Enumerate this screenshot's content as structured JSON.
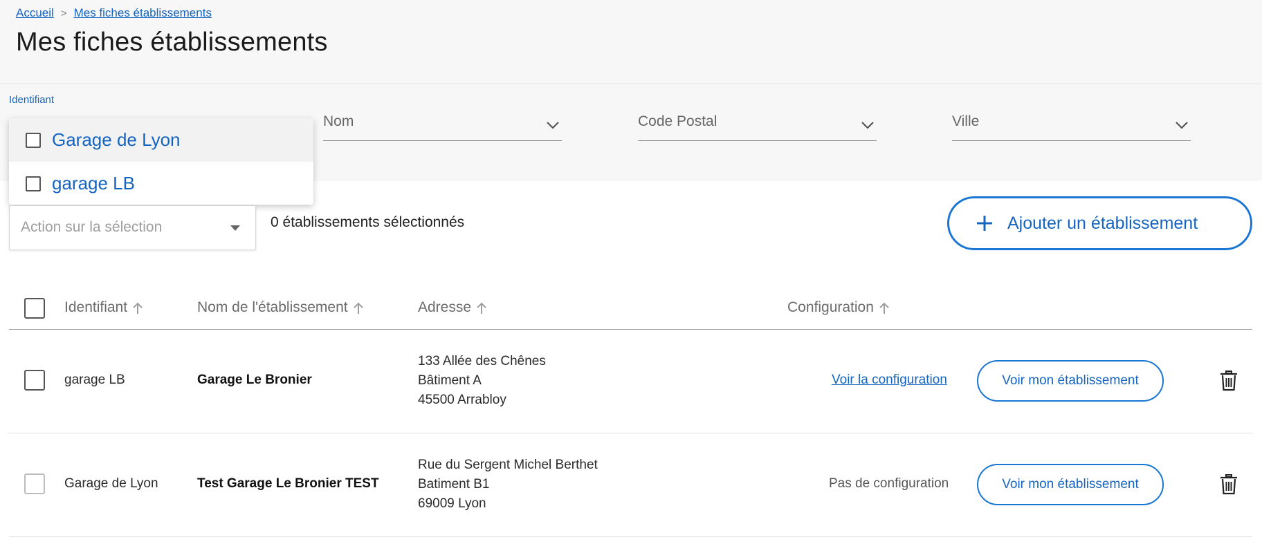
{
  "breadcrumb": {
    "home": "Accueil",
    "separator": ">",
    "current": "Mes fiches établissements"
  },
  "page_title": "Mes fiches établissements",
  "filters": {
    "identifiant_label": "Identifiant",
    "nom": "Nom",
    "code_postal": "Code Postal",
    "ville": "Ville"
  },
  "identifiant_dropdown": {
    "options": [
      {
        "label": "Garage de Lyon",
        "checked": false,
        "hovered": true
      },
      {
        "label": "garage LB",
        "checked": false,
        "hovered": false
      }
    ]
  },
  "selection": {
    "action_placeholder": "Action sur la sélection",
    "count_text": "0 établissements sélectionnés"
  },
  "add_button": {
    "label": "Ajouter un établissement",
    "icon": "plus-icon"
  },
  "table": {
    "headers": {
      "identifiant": "Identifiant",
      "nom": "Nom de l'établissement",
      "adresse": "Adresse",
      "configuration": "Configuration"
    },
    "rows": [
      {
        "identifiant": "garage LB",
        "nom": "Garage Le Bronier",
        "adresse": [
          "133 Allée des Chênes",
          "Bâtiment A",
          "45500 Arrabloy"
        ],
        "configuration": "Voir la configuration",
        "has_configuration": true,
        "voir_label": "Voir mon établissement"
      },
      {
        "identifiant": "Garage de Lyon",
        "nom": "Test Garage Le Bronier TEST",
        "adresse": [
          "Rue du Sergent Michel Berthet",
          "Batiment B1",
          "69009 Lyon"
        ],
        "configuration": "Pas de configuration",
        "has_configuration": false,
        "voir_label": "Voir mon établissement"
      }
    ]
  },
  "colors": {
    "accent": "#1565c0",
    "border_accent": "#1976d2",
    "header_bg": "#f7f7f7"
  }
}
